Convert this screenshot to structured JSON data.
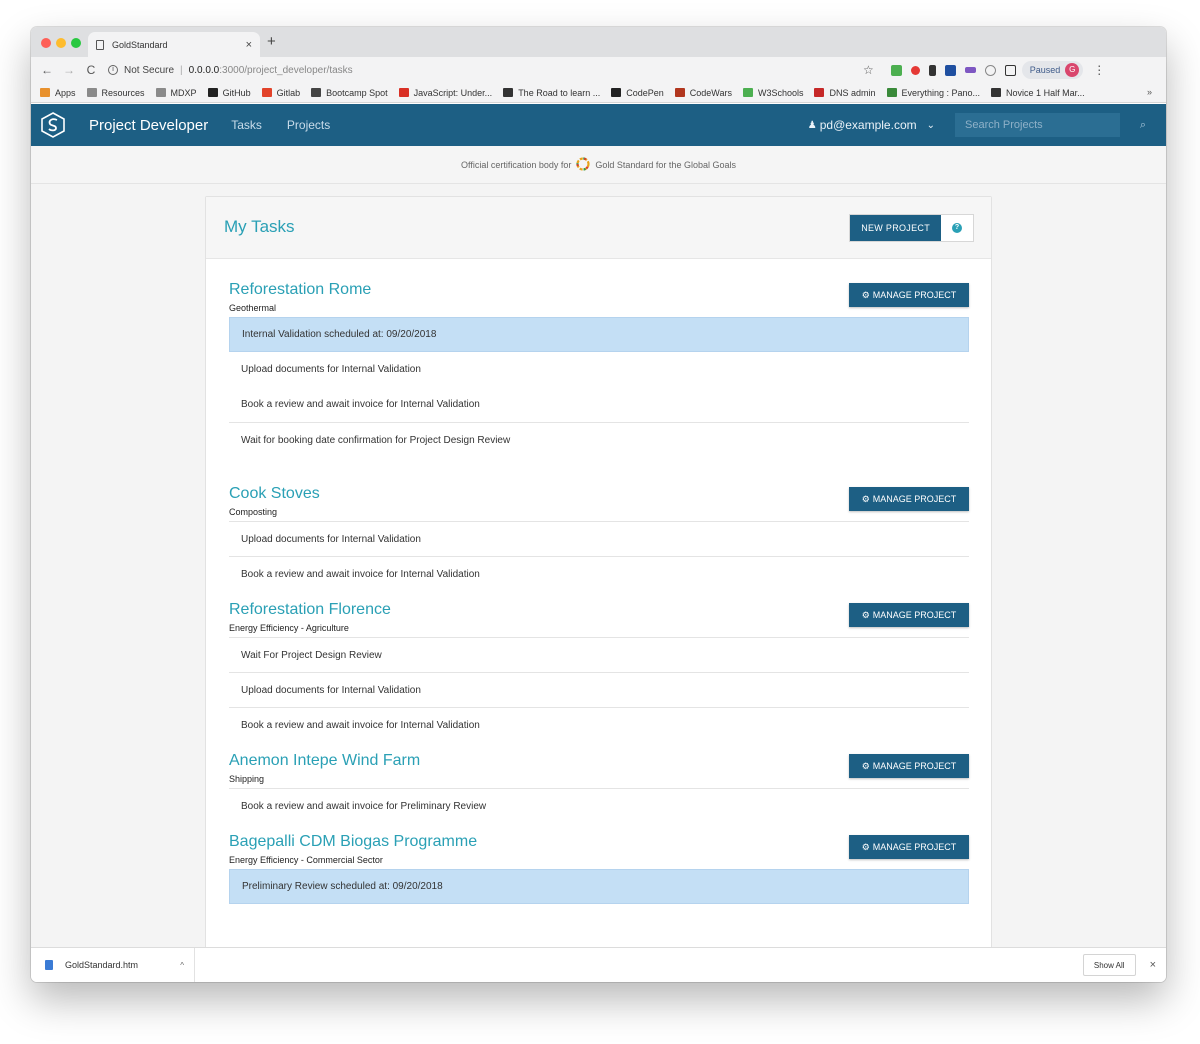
{
  "browser": {
    "tab_title": "GoldStandard",
    "tab_close": "×",
    "new_tab": "+",
    "nav_back": "←",
    "nav_forward": "→",
    "nav_reload": "C",
    "security_text": "Not Secure",
    "url_host": "0.0.0.0",
    "url_path": ":3000/project_developer/tasks",
    "star": "☆",
    "profile_status": "Paused",
    "profile_initial": "G",
    "menu": "⋮"
  },
  "bookmarks": [
    {
      "label": "Apps",
      "color": "#e8912d"
    },
    {
      "label": "Resources",
      "color": "#8a8a8a"
    },
    {
      "label": "MDXP",
      "color": "#8a8a8a"
    },
    {
      "label": "GitHub",
      "color": "#222222"
    },
    {
      "label": "Gitlab",
      "color": "#e2432a"
    },
    {
      "label": "Bootcamp Spot",
      "color": "#444444"
    },
    {
      "label": "JavaScript: Under...",
      "color": "#d93025"
    },
    {
      "label": "The Road to learn ...",
      "color": "#333333"
    },
    {
      "label": "CodePen",
      "color": "#222222"
    },
    {
      "label": "CodeWars",
      "color": "#b1361e"
    },
    {
      "label": "W3Schools",
      "color": "#4caf50"
    },
    {
      "label": "DNS admin",
      "color": "#c62828"
    },
    {
      "label": "Everything : Pano...",
      "color": "#3a8a3a"
    },
    {
      "label": "Novice 1 Half Mar...",
      "color": "#333333"
    }
  ],
  "bookmarks_more": "»",
  "app": {
    "brand": "Project Developer",
    "nav": [
      "Tasks",
      "Projects"
    ],
    "user_email": "pd@example.com",
    "search_placeholder": "Search Projects",
    "search_icon": "⌕",
    "primary_color": "#1d5f84",
    "accent_color": "#2aa0b5"
  },
  "banner": {
    "prefix": "Official certification body for",
    "suffix": "Gold Standard for the Global Goals"
  },
  "main": {
    "title": "My Tasks",
    "new_project_label": "NEW PROJECT",
    "help": "?",
    "manage_label": "MANAGE PROJECT",
    "projects": [
      {
        "name": "Reforestation Rome",
        "category": "Geothermal",
        "tasks": [
          {
            "text": "Internal Validation scheduled at: 09/20/2018",
            "highlight": true
          },
          {
            "text": "Upload documents for Internal Validation",
            "highlight": false
          },
          {
            "text": "Book a review and await invoice for Internal Validation",
            "highlight": false
          },
          {
            "text": "Wait for booking date confirmation for Project Design Review",
            "highlight": false
          }
        ]
      },
      {
        "name": "Cook Stoves",
        "category": "Composting",
        "tasks": [
          {
            "text": "Upload documents for Internal Validation",
            "highlight": false
          },
          {
            "text": "Book a review and await invoice for Internal Validation",
            "highlight": false
          }
        ]
      },
      {
        "name": "Reforestation Florence",
        "category": "Energy Efficiency - Agriculture",
        "tasks": [
          {
            "text": "Wait For Project Design Review",
            "highlight": false
          },
          {
            "text": "Upload documents for Internal Validation",
            "highlight": false
          },
          {
            "text": "Book a review and await invoice for Internal Validation",
            "highlight": false
          }
        ]
      },
      {
        "name": "Anemon Intepe Wind Farm",
        "category": "Shipping",
        "tasks": [
          {
            "text": "Book a review and await invoice for Preliminary Review",
            "highlight": false
          }
        ]
      },
      {
        "name": "Bagepalli CDM Biogas Programme",
        "category": "Energy Efficiency - Commercial Sector",
        "tasks": [
          {
            "text": "Preliminary Review scheduled at: 09/20/2018",
            "highlight": true
          }
        ]
      }
    ]
  },
  "downloads": {
    "file": "GoldStandard.htm",
    "chevron": "^",
    "show_all": "Show All",
    "close": "×"
  }
}
